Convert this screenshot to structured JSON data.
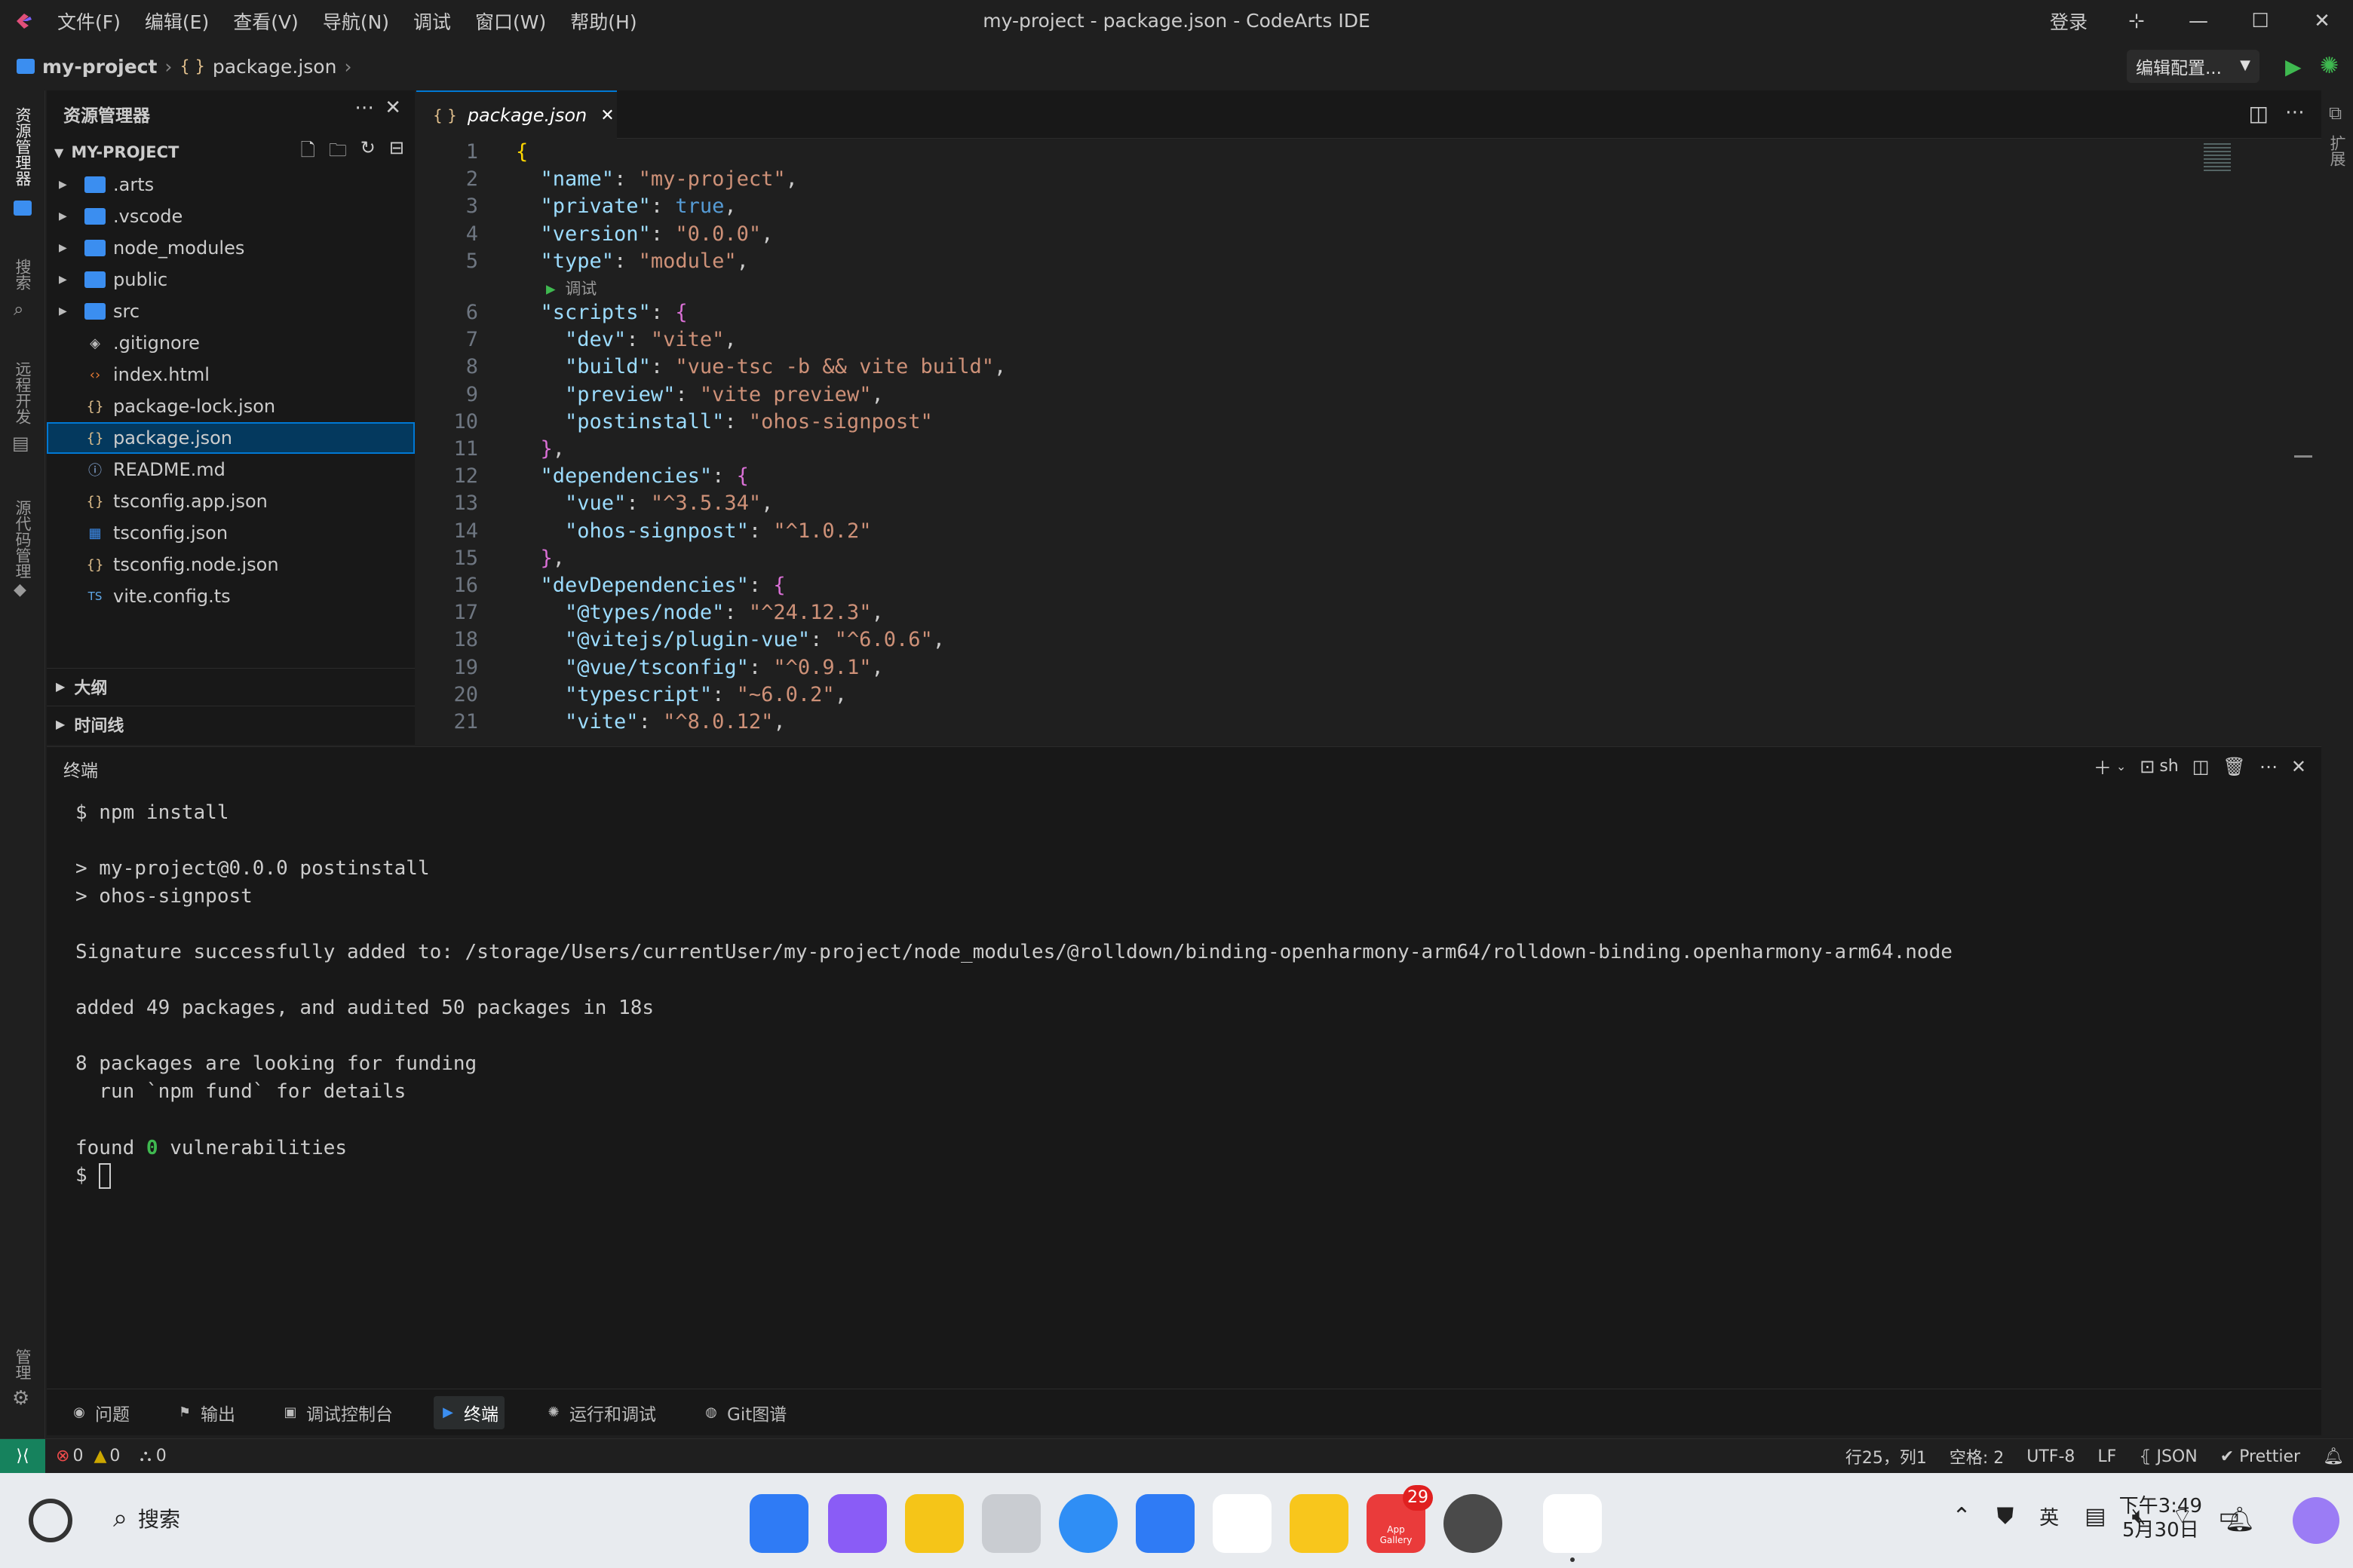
{
  "window": {
    "title": "my-project - package.json - CodeArts IDE",
    "menu": [
      "文件(F)",
      "编辑(E)",
      "查看(V)",
      "导航(N)",
      "调试",
      "窗口(W)",
      "帮助(H)"
    ],
    "login_label": "登录"
  },
  "breadcrumb": {
    "project": "my-project",
    "file_icon": "{ }",
    "file": "package.json"
  },
  "run_config": {
    "label": "编辑配置..."
  },
  "activity_bar": {
    "items": [
      "资源管理器",
      "搜索",
      "远程开发",
      "源代码管理"
    ],
    "bottom": "管理"
  },
  "right_rail": {
    "label": "扩展"
  },
  "explorer": {
    "title": "资源管理器",
    "project_label": "MY-PROJECT",
    "items": [
      {
        "name": ".arts",
        "type": "folder",
        "icon": "folder-icon"
      },
      {
        "name": ".vscode",
        "type": "folder",
        "icon": "folder-icon"
      },
      {
        "name": "node_modules",
        "type": "folder",
        "icon": "folder-icon"
      },
      {
        "name": "public",
        "type": "folder",
        "icon": "folder-icon"
      },
      {
        "name": "src",
        "type": "folder",
        "icon": "folder-icon"
      },
      {
        "name": ".gitignore",
        "type": "file",
        "icon": "git-icon"
      },
      {
        "name": "index.html",
        "type": "file",
        "icon": "html-icon"
      },
      {
        "name": "package-lock.json",
        "type": "file",
        "icon": "json-icon"
      },
      {
        "name": "package.json",
        "type": "file",
        "icon": "json-icon",
        "selected": true
      },
      {
        "name": "README.md",
        "type": "file",
        "icon": "info-icon"
      },
      {
        "name": "tsconfig.app.json",
        "type": "file",
        "icon": "json-icon"
      },
      {
        "name": "tsconfig.json",
        "type": "file",
        "icon": "ts-config-icon"
      },
      {
        "name": "tsconfig.node.json",
        "type": "file",
        "icon": "json-icon"
      },
      {
        "name": "vite.config.ts",
        "type": "file",
        "icon": "ts-icon"
      }
    ],
    "sections": [
      "大纲",
      "时间线"
    ]
  },
  "editor": {
    "tab": {
      "icon": "{ }",
      "label": "package.json"
    },
    "codelens": "调试",
    "lines": [
      {
        "n": 1,
        "text": "{"
      },
      {
        "n": 2,
        "text": "  \"name\": \"my-project\","
      },
      {
        "n": 3,
        "text": "  \"private\": true,"
      },
      {
        "n": 4,
        "text": "  \"version\": \"0.0.0\","
      },
      {
        "n": 5,
        "text": "  \"type\": \"module\","
      },
      {
        "n": 6,
        "text": "  \"scripts\": {"
      },
      {
        "n": 7,
        "text": "    \"dev\": \"vite\","
      },
      {
        "n": 8,
        "text": "    \"build\": \"vue-tsc -b && vite build\","
      },
      {
        "n": 9,
        "text": "    \"preview\": \"vite preview\","
      },
      {
        "n": 10,
        "text": "    \"postinstall\": \"ohos-signpost\""
      },
      {
        "n": 11,
        "text": "  },"
      },
      {
        "n": 12,
        "text": "  \"dependencies\": {"
      },
      {
        "n": 13,
        "text": "    \"vue\": \"^3.5.34\","
      },
      {
        "n": 14,
        "text": "    \"ohos-signpost\": \"^1.0.2\""
      },
      {
        "n": 15,
        "text": "  },"
      },
      {
        "n": 16,
        "text": "  \"devDependencies\": {"
      },
      {
        "n": 17,
        "text": "    \"@types/node\": \"^24.12.3\","
      },
      {
        "n": 18,
        "text": "    \"@vitejs/plugin-vue\": \"^6.0.6\","
      },
      {
        "n": 19,
        "text": "    \"@vue/tsconfig\": \"^0.9.1\","
      },
      {
        "n": 20,
        "text": "    \"typescript\": \"~6.0.2\","
      },
      {
        "n": 21,
        "text": "    \"vite\": \"^8.0.12\","
      }
    ]
  },
  "terminal": {
    "title": "终端",
    "shell": "sh",
    "lines": [
      "$ npm install",
      "",
      "> my-project@0.0.0 postinstall",
      "> ohos-signpost",
      "",
      "Signature successfully added to: /storage/Users/currentUser/my-project/node_modules/@rolldown/binding-openharmony-arm64/rolldown-binding.openharmony-arm64.node",
      "",
      "added 49 packages, and audited 50 packages in 18s",
      "",
      "8 packages are looking for funding",
      "  run `npm fund` for details",
      ""
    ],
    "found_prefix": "found ",
    "found_count": "0",
    "found_suffix": " vulnerabilities",
    "prompt": "$ "
  },
  "panel_tabs": [
    {
      "label": "问题",
      "icon": "problems-icon"
    },
    {
      "label": "输出",
      "icon": "output-icon"
    },
    {
      "label": "调试控制台",
      "icon": "debug-console-icon"
    },
    {
      "label": "终端",
      "icon": "terminal-icon",
      "active": true
    },
    {
      "label": "运行和调试",
      "icon": "run-debug-icon"
    },
    {
      "label": "Git图谱",
      "icon": "git-graph-icon"
    }
  ],
  "status_bar": {
    "errors": "0",
    "warnings": "0",
    "ports": "0",
    "position": "行25，列1",
    "spaces": "空格: 2",
    "encoding": "UTF-8",
    "eol": "LF",
    "language": "JSON",
    "formatter": "Prettier"
  },
  "taskbar": {
    "search_label": "搜索",
    "badge_count": "29",
    "app_gallery_label": "App Gallery",
    "ime": "英",
    "time": "下午3:49",
    "date": "5月30日"
  },
  "colors": {
    "accent": "#0078d4",
    "key": "#9cdcfe",
    "string": "#ce9178",
    "bool": "#569cd6",
    "remote": "#16825d"
  }
}
